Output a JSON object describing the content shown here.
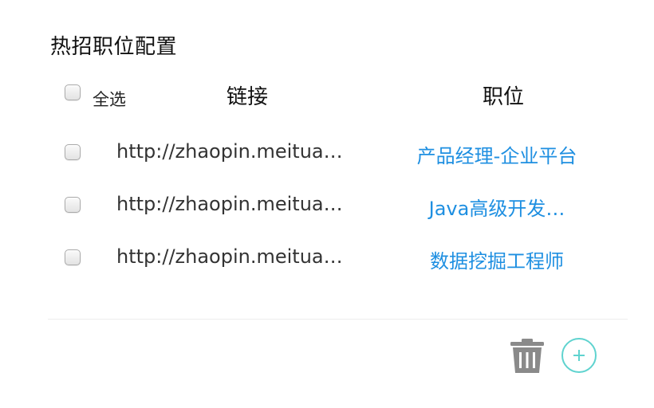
{
  "panel": {
    "title": "热招职位配置"
  },
  "table": {
    "select_all_label": "全选",
    "columns": {
      "link": "链接",
      "position": "职位"
    },
    "rows": [
      {
        "link": "http://zhaopin.meitua…",
        "position": "产品经理-企业平台"
      },
      {
        "link": "http://zhaopin.meitua…",
        "position": "Java高级开发…"
      },
      {
        "link": "http://zhaopin.meitua…",
        "position": "数据挖掘工程师"
      }
    ]
  },
  "footer": {
    "delete_icon": "trash-icon",
    "add_icon": "plus-circle-icon"
  },
  "colors": {
    "link_blue": "#1e8fe1",
    "add_accent": "#5fd3cf",
    "trash_gray": "#8a8a8a"
  }
}
